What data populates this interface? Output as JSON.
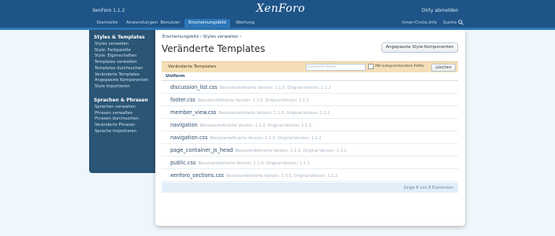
{
  "header": {
    "version": "XenForo 1.1.2",
    "logo": "XenForo",
    "user_link": "Dirty abmelden",
    "site_link": "Inner-Circle.info",
    "search_label": "Suche",
    "tabs": [
      {
        "label": "Startseite"
      },
      {
        "label": "Anwendungen"
      },
      {
        "label": "Benutzer"
      },
      {
        "label": "Erscheinungsbild"
      },
      {
        "label": "Wartung"
      }
    ]
  },
  "sidebar": {
    "section1_title": "Styles & Templates",
    "section1_items": [
      "Styles verwalten",
      "Style: Farbpalette",
      "Style: Eigenschaften",
      "Templates verwalten",
      "Templates durchsuchen",
      "Veränderte Templates",
      "Angepasste Komponenten",
      "Style importieren"
    ],
    "section2_title": "Sprachen & Phrasen",
    "section2_items": [
      "Sprachen verwalten",
      "Phrasen verwalten",
      "Phrasen durchsuchen",
      "Veränderte Phrasen",
      "Sprache importieren"
    ]
  },
  "content": {
    "breadcrumb": [
      "Erscheinungsbild ›",
      "Styles verwalten ›"
    ],
    "title": "Veränderte Templates",
    "custom_button": "Angepasste Style-Komponenten",
    "list_title": "Veränderte Templates",
    "filter_placeholder": "Elemente filtern",
    "prefix_label": "Mit entsprechendem Präfix",
    "clear_button": "Löschen",
    "group": "Uniform",
    "rows": [
      {
        "name": "discussion_list.css",
        "meta": "Benutzerdefinierte Version: 1.1.0, Original-Version: 1.1.2"
      },
      {
        "name": "footer.css",
        "meta": "Benutzerdefinierte Version: 1.1.0, Original-Version: 1.1.2"
      },
      {
        "name": "member_view.css",
        "meta": "Benutzerdefinierte Version: 1.1.0, Original-Version: 1.1.2"
      },
      {
        "name": "navigation",
        "meta": "Benutzerdefinierte Version: 1.1.0, Original-Version: 1.1.2"
      },
      {
        "name": "navigation.css",
        "meta": "Benutzerdefinierte Version: 1.1.0, Original-Version: 1.1.2"
      },
      {
        "name": "page_container_js_head",
        "meta": "Benutzerdefinierte Version: 1.1.1, Original-Version: 1.1.2"
      },
      {
        "name": "public.css",
        "meta": "Benutzerdefinierte Version: 1.1.0, Original-Version: 1.1.2"
      },
      {
        "name": "xenforo_sections.css",
        "meta": "Benutzerdefinierte Version: 1.0.0, Original-Version: 1.1.2"
      }
    ],
    "footer": "Zeige 8 von 8 Elementen"
  }
}
